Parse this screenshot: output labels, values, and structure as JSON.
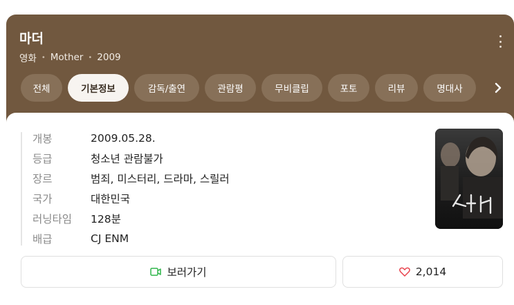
{
  "header": {
    "title": "마더",
    "type": "영화",
    "original_title": "Mother",
    "year": "2009"
  },
  "tabs": [
    {
      "label": "전체",
      "active": false
    },
    {
      "label": "기본정보",
      "active": true
    },
    {
      "label": "감독/출연",
      "active": false
    },
    {
      "label": "관람평",
      "active": false
    },
    {
      "label": "무비클립",
      "active": false
    },
    {
      "label": "포토",
      "active": false
    },
    {
      "label": "리뷰",
      "active": false
    },
    {
      "label": "명대사",
      "active": false
    }
  ],
  "info": [
    {
      "label": "개봉",
      "value": "2009.05.28."
    },
    {
      "label": "등급",
      "value": "청소년 관람불가"
    },
    {
      "label": "장르",
      "value": "범죄, 미스터리, 드라마, 스릴러"
    },
    {
      "label": "국가",
      "value": "대한민국"
    },
    {
      "label": "러닝타임",
      "value": "128분"
    },
    {
      "label": "배급",
      "value": "CJ ENM"
    }
  ],
  "actions": {
    "watch_label": "보러가기",
    "like_count": "2,014"
  },
  "colors": {
    "header_bg": "#71583f",
    "tab_bg": "#877058",
    "watch_icon": "#2fb54a",
    "heart_icon": "#e8424c"
  },
  "icons": {
    "more": "more-vertical-icon",
    "next": "chevron-right-icon",
    "watch": "video-camera-icon",
    "like": "heart-icon"
  }
}
